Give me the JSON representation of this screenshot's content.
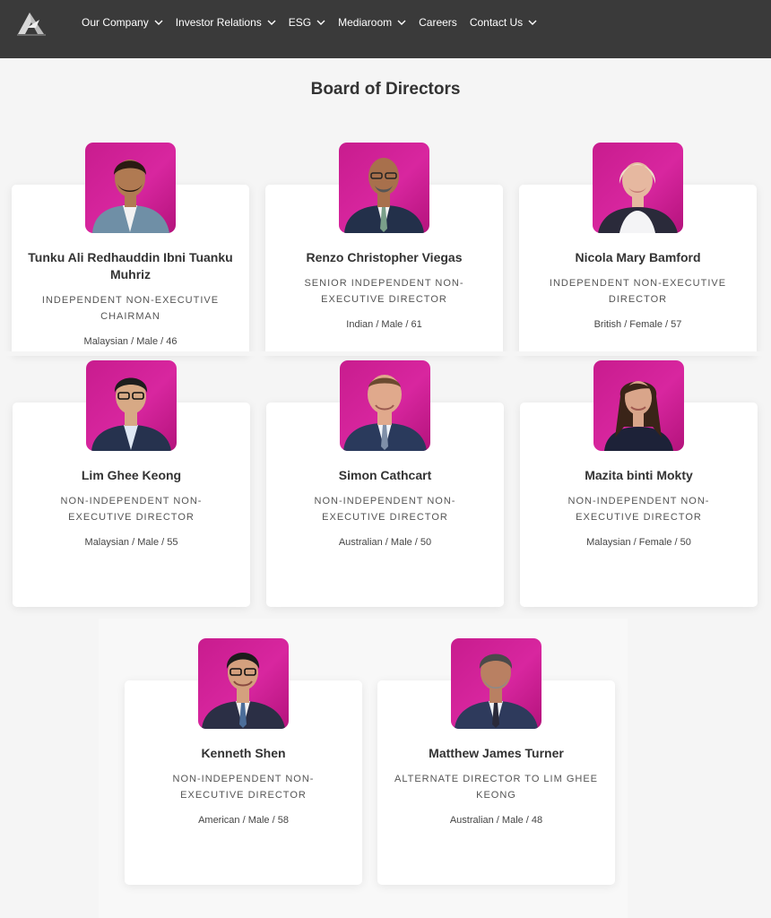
{
  "nav": {
    "items": [
      {
        "label": "Our Company",
        "has_dropdown": true
      },
      {
        "label": "Investor Relations",
        "has_dropdown": true
      },
      {
        "label": "ESG",
        "has_dropdown": true
      },
      {
        "label": "Mediaroom",
        "has_dropdown": true
      },
      {
        "label": "Careers",
        "has_dropdown": false
      },
      {
        "label": "Contact Us",
        "has_dropdown": true
      }
    ]
  },
  "page": {
    "title": "Board of Directors"
  },
  "directors": [
    {
      "name": "Tunku Ali Redhauddin Ibni Tuanku Muhriz",
      "role": "INDEPENDENT NON-EXECUTIVE CHAIRMAN",
      "meta": "Malaysian / Male / 46"
    },
    {
      "name": "Renzo Christopher Viegas",
      "role": "SENIOR INDEPENDENT NON-EXECUTIVE DIRECTOR",
      "meta": "Indian / Male / 61"
    },
    {
      "name": "Nicola Mary Bamford",
      "role": "INDEPENDENT NON-EXECUTIVE DIRECTOR",
      "meta": "British / Female / 57"
    },
    {
      "name": "Lim Ghee Keong",
      "role": "NON-INDEPENDENT NON-EXECUTIVE DIRECTOR",
      "meta": "Malaysian / Male / 55"
    },
    {
      "name": "Simon Cathcart",
      "role": "NON-INDEPENDENT NON-EXECUTIVE DIRECTOR",
      "meta": "Australian / Male / 50"
    },
    {
      "name": "Mazita binti Mokty",
      "role": "NON-INDEPENDENT NON-EXECUTIVE DIRECTOR",
      "meta": "Malaysian / Female / 50"
    },
    {
      "name": "Kenneth Shen",
      "role": "NON-INDEPENDENT NON-EXECUTIVE DIRECTOR",
      "meta": "American / Male / 58"
    },
    {
      "name": "Matthew James Turner",
      "role": "ALTERNATE DIRECTOR TO LIM GHEE KEONG",
      "meta": "Australian / Male / 48"
    }
  ],
  "colors": {
    "navbar": "#3a3a3a",
    "photo_bg": "#d21f97",
    "page_bg": "#f5f5f5"
  }
}
